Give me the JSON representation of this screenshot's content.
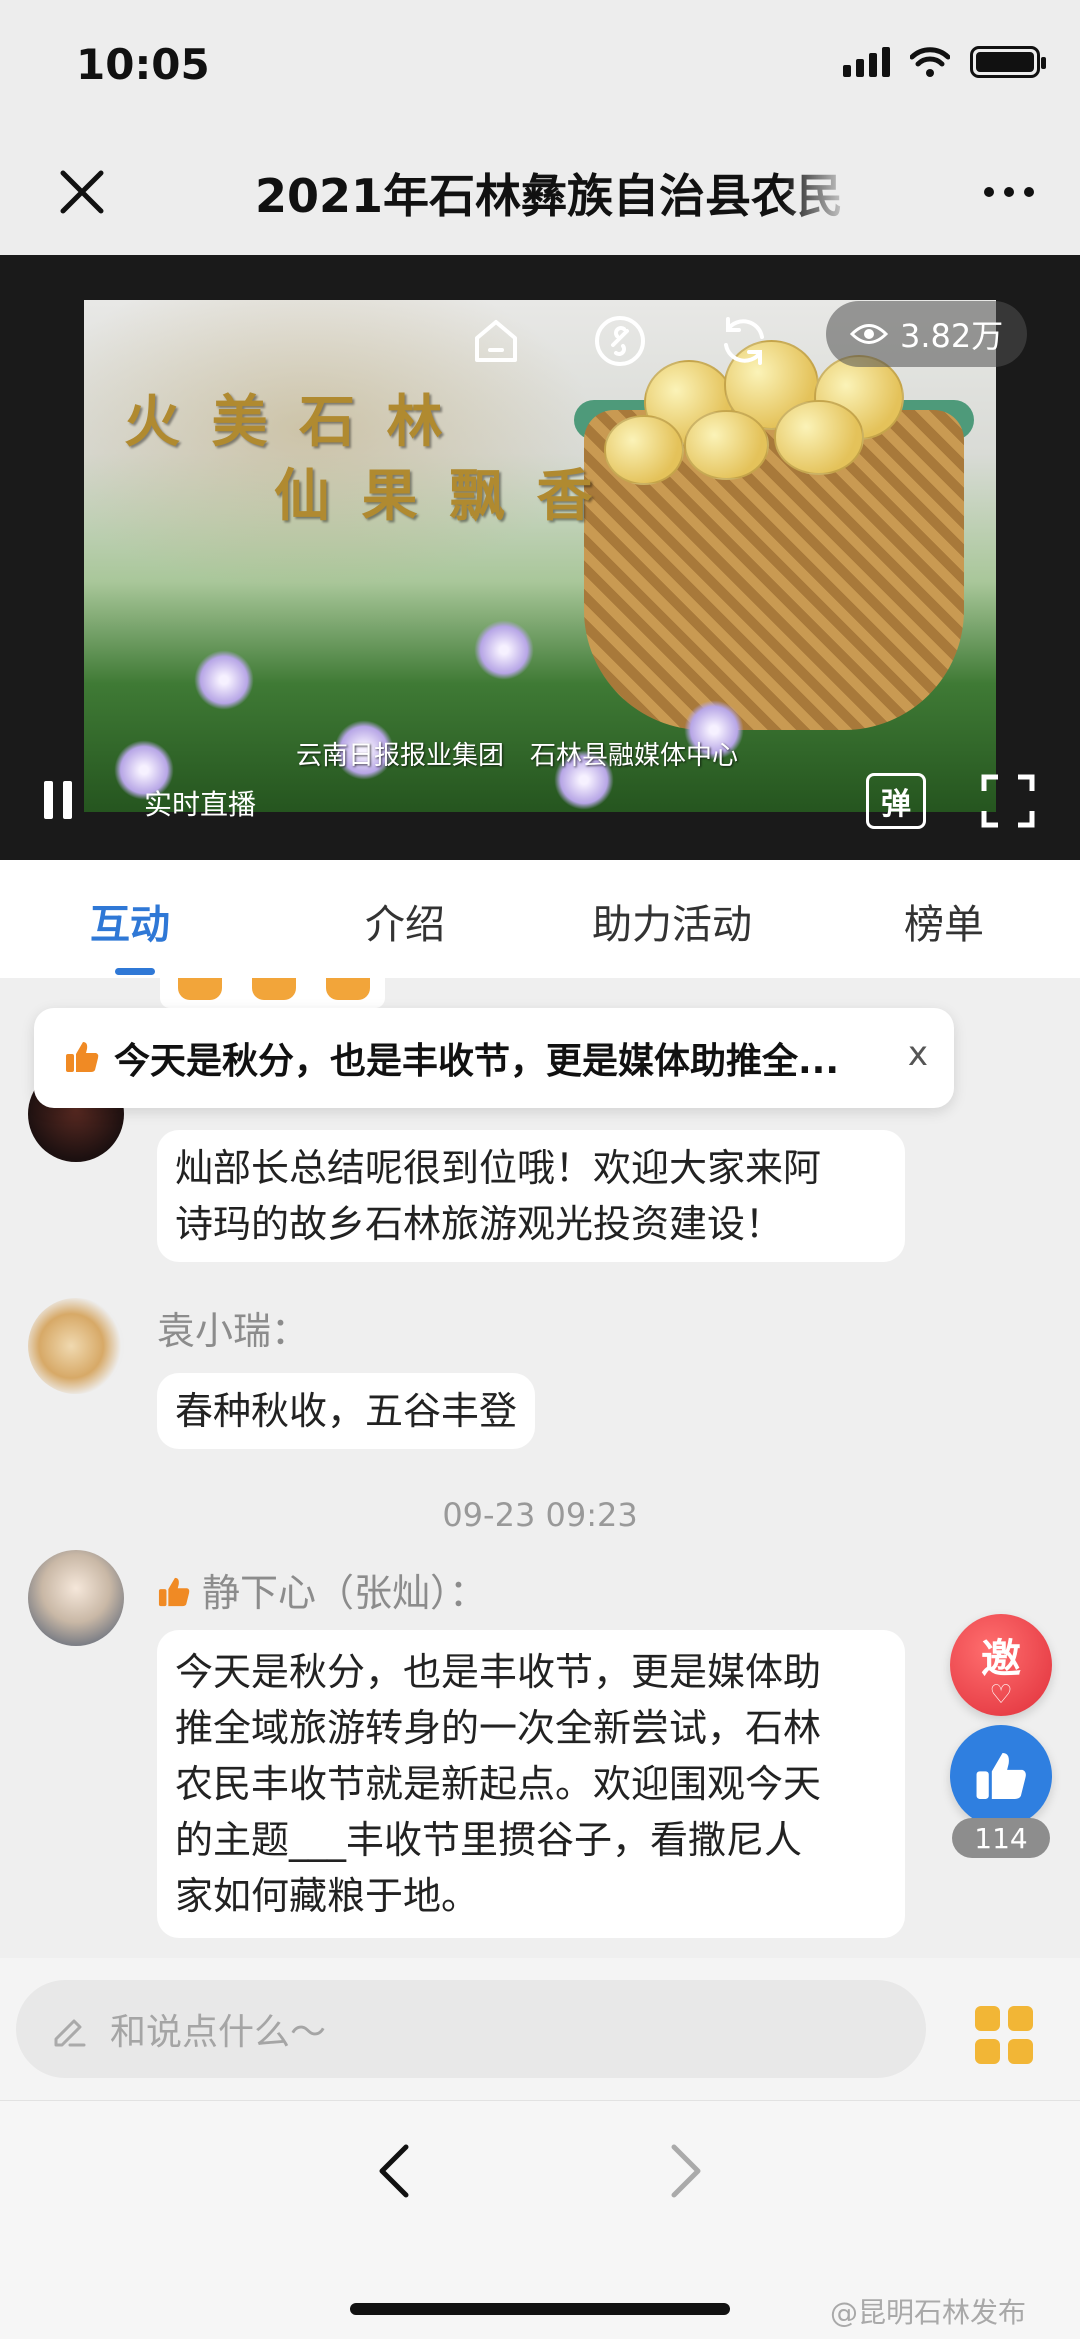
{
  "status_bar": {
    "time": "10:05"
  },
  "nav": {
    "title": "2021年石林彝族自治县农民"
  },
  "player": {
    "video_title_line1": "火 美 石 林",
    "video_title_line2": "仙 果 飘 香",
    "credits": "云南日报报业集团　石林县融媒体中心",
    "view_count": "3.82万",
    "live_label": "实时直播",
    "danmu_label": "弹"
  },
  "tabs": [
    {
      "label": "互动",
      "active": true
    },
    {
      "label": "介绍",
      "active": false
    },
    {
      "label": "助力活动",
      "active": false
    },
    {
      "label": "榜单",
      "active": false
    }
  ],
  "banner": {
    "text": "今天是秋分，也是丰收节，更是媒体助推全...",
    "close": "x"
  },
  "messages": [
    {
      "nickname": "",
      "text": "灿部长总结呢很到位哦！欢迎大家来阿诗玛的故乡石林旅游观光投资建设！",
      "lines": [
        "灿部长总结呢很到位哦！欢迎大家来阿",
        "诗玛的故乡石林旅游观光投资建设！"
      ]
    },
    {
      "nickname": "袁小瑞：",
      "text": "春种秋收，五谷丰登"
    },
    {
      "timestamp": "09-23 09:23"
    },
    {
      "nickname": "静下心（张灿）：",
      "lines": [
        "今天是秋分，也是丰收节，更是媒体助",
        "推全域旅游转身的一次全新尝试，石林",
        "农民丰收节就是新起点。欢迎围观今天",
        "的主题___丰收节里掼谷子，看撒尼人",
        "家如何藏粮于地。"
      ]
    }
  ],
  "floating": {
    "invite_label": "邀",
    "like_count": "114"
  },
  "input": {
    "placeholder": "和说点什么～"
  },
  "watermark": "@昆明石林发布",
  "colors": {
    "accent": "#2f78d6",
    "invite": "#e02f3a",
    "like": "#2f7fe0",
    "grid_icon": "#f2b636"
  }
}
